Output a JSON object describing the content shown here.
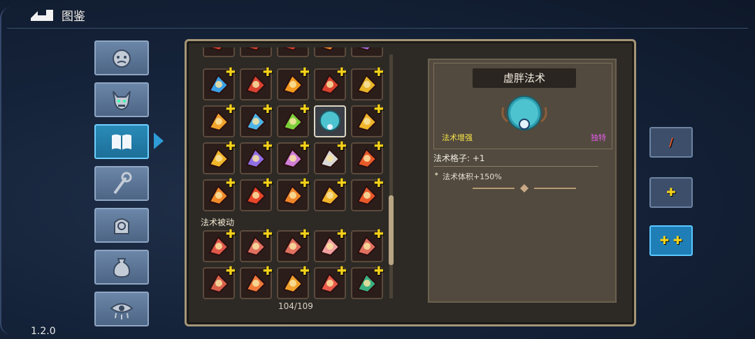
{
  "header": {
    "title": "图鉴"
  },
  "version": "1.2.0",
  "categories": [
    {
      "icon": "monster-face-icon",
      "active": false
    },
    {
      "icon": "boss-demon-icon",
      "active": false
    },
    {
      "icon": "spellbook-icon",
      "active": true
    },
    {
      "icon": "staff-icon",
      "active": false
    },
    {
      "icon": "relic-hand-icon",
      "active": false
    },
    {
      "icon": "potion-bag-icon",
      "active": false
    },
    {
      "icon": "eye-icon",
      "active": false
    }
  ],
  "grid": {
    "section_label": "法术被动",
    "counter": "104/109",
    "rows": [
      [
        "red",
        "red",
        "red",
        "orange",
        "purple"
      ],
      [
        "water-fountain",
        "red-rose",
        "fire-burst",
        "red-claw",
        "gold-rune"
      ],
      [
        "orange-claw",
        "blue-ghost",
        "green-arc",
        "bubble-orb",
        "gold-arrows"
      ],
      [
        "gold-eye",
        "purple-spark",
        "pink-clock",
        "crosshair",
        "fire-arrow"
      ],
      [
        "orange-shot",
        "red-star",
        "crossed-swords",
        "gold-cycle",
        "red-wing"
      ],
      [
        "red-cube",
        "pink-gem",
        "hex-shield",
        "pink-bubble",
        "hourglass"
      ],
      [
        "red-rock",
        "gold-diamond",
        "sound-wave",
        "red-spray",
        "green-orb"
      ]
    ],
    "selected": "bubble-orb"
  },
  "detail": {
    "name": "虚胖法术",
    "type": "法术增强",
    "rarity": "独特",
    "slot_text": "法术格子: +1",
    "effect": "法术体积+150%"
  },
  "right_buttons": [
    {
      "label": "/",
      "icon": "no-upgrade-icon",
      "active": false
    },
    {
      "label": "✚",
      "icon": "plus-icon",
      "active": false
    },
    {
      "label": "✚ ✚",
      "icon": "double-plus-icon",
      "active": true
    }
  ],
  "colors": {
    "accent": "#2e9cd6",
    "plus": "#f5d21b",
    "type": "#f6e44a",
    "rarity": "#e25de6"
  }
}
